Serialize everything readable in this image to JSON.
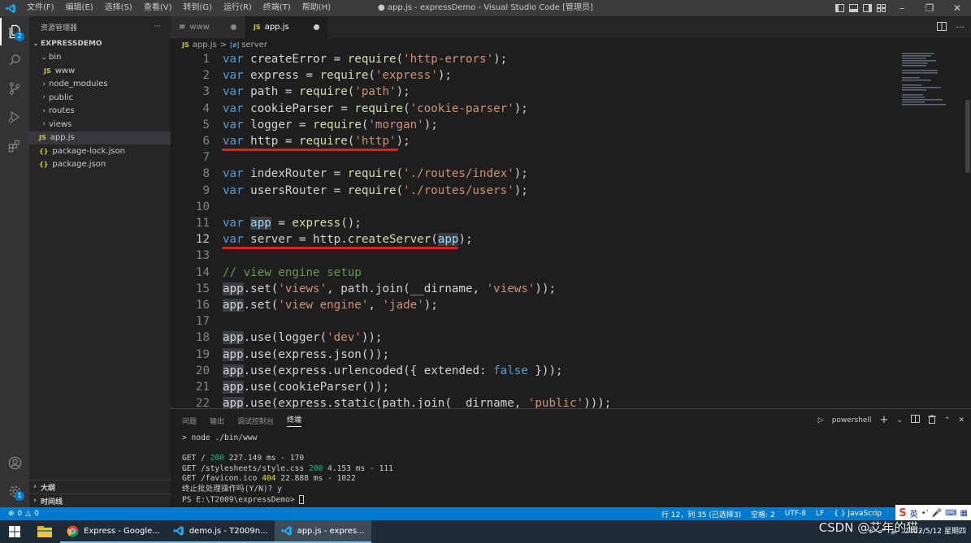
{
  "titlebar": {
    "menu": [
      "文件(F)",
      "编辑(E)",
      "选择(S)",
      "查看(V)",
      "转到(G)",
      "运行(R)",
      "终端(T)",
      "帮助(H)"
    ],
    "title": "● app.js - expressDemo - Visual Studio Code [管理员]"
  },
  "activitybar": {
    "explorer_badge": "2",
    "settings_badge": "1"
  },
  "sidebar": {
    "header": "资源管理器",
    "more": "···",
    "project": "EXPRESSDEMO",
    "items": [
      {
        "label": "bin",
        "kind": "folder-open"
      },
      {
        "label": "www",
        "kind": "js"
      },
      {
        "label": "node_modules",
        "kind": "folder"
      },
      {
        "label": "public",
        "kind": "folder"
      },
      {
        "label": "routes",
        "kind": "folder"
      },
      {
        "label": "views",
        "kind": "folder"
      },
      {
        "label": "app.js",
        "kind": "js"
      },
      {
        "label": "package-lock.json",
        "kind": "json"
      },
      {
        "label": "package.json",
        "kind": "json"
      }
    ],
    "outline": "大纲",
    "timeline": "时间线"
  },
  "tabs": [
    {
      "label": "www",
      "icon": "≡"
    },
    {
      "label": "app.js",
      "icon": "JS"
    }
  ],
  "breadcrumb": {
    "file": "app.js",
    "separator": ">",
    "symbol": "server"
  },
  "editor": {
    "current_line": 12,
    "lines": [
      {
        "n": "1"
      },
      {
        "n": "2"
      },
      {
        "n": "3"
      },
      {
        "n": "4"
      },
      {
        "n": "5"
      },
      {
        "n": "6"
      },
      {
        "n": "7"
      },
      {
        "n": "8"
      },
      {
        "n": "9"
      },
      {
        "n": "10"
      },
      {
        "n": "11"
      },
      {
        "n": "12"
      },
      {
        "n": "13"
      },
      {
        "n": "14"
      },
      {
        "n": "15"
      },
      {
        "n": "16"
      },
      {
        "n": "17"
      },
      {
        "n": "18"
      },
      {
        "n": "19"
      },
      {
        "n": "20"
      },
      {
        "n": "21"
      },
      {
        "n": "22"
      }
    ],
    "code": [
      [
        [
          "k",
          "var"
        ],
        [
          "p",
          " createError = "
        ],
        [
          "f",
          "require"
        ],
        [
          "p",
          "("
        ],
        [
          "s",
          "'http-errors'"
        ],
        [
          "p",
          ");"
        ]
      ],
      [
        [
          "k",
          "var"
        ],
        [
          "p",
          " express = "
        ],
        [
          "f",
          "require"
        ],
        [
          "p",
          "("
        ],
        [
          "s",
          "'express'"
        ],
        [
          "p",
          ");"
        ]
      ],
      [
        [
          "k",
          "var"
        ],
        [
          "p",
          " path = "
        ],
        [
          "f",
          "require"
        ],
        [
          "p",
          "("
        ],
        [
          "s",
          "'path'"
        ],
        [
          "p",
          ");"
        ]
      ],
      [
        [
          "k",
          "var"
        ],
        [
          "p",
          " cookieParser = "
        ],
        [
          "f",
          "require"
        ],
        [
          "p",
          "("
        ],
        [
          "s",
          "'cookie-parser'"
        ],
        [
          "p",
          ");"
        ]
      ],
      [
        [
          "k",
          "var"
        ],
        [
          "p",
          " logger = "
        ],
        [
          "f",
          "require"
        ],
        [
          "p",
          "("
        ],
        [
          "s",
          "'morgan'"
        ],
        [
          "p",
          ");"
        ]
      ],
      [
        [
          "k",
          "var"
        ],
        [
          "p",
          " http = "
        ],
        [
          "f",
          "require"
        ],
        [
          "p",
          "("
        ],
        [
          "s",
          "'http'"
        ],
        [
          "p",
          ");"
        ]
      ],
      [],
      [
        [
          "k",
          "var"
        ],
        [
          "p",
          " indexRouter = "
        ],
        [
          "f",
          "require"
        ],
        [
          "p",
          "("
        ],
        [
          "s",
          "'./routes/index'"
        ],
        [
          "p",
          ");"
        ]
      ],
      [
        [
          "k",
          "var"
        ],
        [
          "p",
          " usersRouter = "
        ],
        [
          "f",
          "require"
        ],
        [
          "p",
          "("
        ],
        [
          "s",
          "'./routes/users'"
        ],
        [
          "p",
          ");"
        ]
      ],
      [],
      [
        [
          "k",
          "var"
        ],
        [
          "p",
          " "
        ],
        [
          "vh",
          "app"
        ],
        [
          "p",
          " = "
        ],
        [
          "f",
          "express"
        ],
        [
          "p",
          "();"
        ]
      ],
      [
        [
          "k",
          "var"
        ],
        [
          "p",
          " server = http."
        ],
        [
          "f",
          "createServer"
        ],
        [
          "p",
          "("
        ],
        [
          "vh",
          "app"
        ],
        [
          "p",
          ");"
        ]
      ],
      [],
      [
        [
          "c",
          "// view engine setup"
        ]
      ],
      [
        [
          "ph",
          "app"
        ],
        [
          "p",
          ".set("
        ],
        [
          "s",
          "'views'"
        ],
        [
          "p",
          ", path.join(__dirname, "
        ],
        [
          "s",
          "'views'"
        ],
        [
          "p",
          "));"
        ]
      ],
      [
        [
          "ph",
          "app"
        ],
        [
          "p",
          ".set("
        ],
        [
          "s",
          "'view engine'"
        ],
        [
          "p",
          ", "
        ],
        [
          "s",
          "'jade'"
        ],
        [
          "p",
          ");"
        ]
      ],
      [],
      [
        [
          "ph",
          "app"
        ],
        [
          "p",
          ".use(logger("
        ],
        [
          "s",
          "'dev'"
        ],
        [
          "p",
          "));"
        ]
      ],
      [
        [
          "ph",
          "app"
        ],
        [
          "p",
          ".use(express.json());"
        ]
      ],
      [
        [
          "ph",
          "app"
        ],
        [
          "p",
          ".use(express.urlencoded({ extended: "
        ],
        [
          "k",
          "false"
        ],
        [
          "p",
          " }));"
        ]
      ],
      [
        [
          "ph",
          "app"
        ],
        [
          "p",
          ".use(cookieParser());"
        ]
      ],
      [
        [
          "ph",
          "app"
        ],
        [
          "p",
          ".use(express.static(path.join(__dirname, "
        ],
        [
          "s",
          "'public'"
        ],
        [
          "p",
          ")));"
        ]
      ]
    ]
  },
  "panel": {
    "tabs": [
      "问题",
      "输出",
      "调试控制台",
      "终端"
    ],
    "active_tab": "终端",
    "shell": "powershell",
    "terminal": [
      {
        "parts": [
          [
            "p",
            "> node ./bin/www"
          ]
        ]
      },
      {
        "parts": [
          [
            "p",
            ""
          ]
        ]
      },
      {
        "parts": [
          [
            "p",
            "GET / "
          ],
          [
            "g",
            "200"
          ],
          [
            "p",
            " 227.149 ms - 170"
          ]
        ]
      },
      {
        "parts": [
          [
            "p",
            "GET /stylesheets/style.css "
          ],
          [
            "g",
            "200"
          ],
          [
            "p",
            " 4.153 ms - 111"
          ]
        ]
      },
      {
        "parts": [
          [
            "p",
            "GET /favicon.ico "
          ],
          [
            "y",
            "404"
          ],
          [
            "p",
            " 22.888 ms - 1022"
          ]
        ]
      },
      {
        "parts": [
          [
            "p",
            "终止批处理操作吗(Y/N)? y"
          ]
        ]
      },
      {
        "parts": [
          [
            "p",
            "PS E:\\T2009\\expressDemo> "
          ]
        ]
      }
    ]
  },
  "statusbar": {
    "errors": "0",
    "warnings": "0",
    "position": "行 12，列 35 (已选择3)",
    "spaces": "空格: 2",
    "encoding": "UTF-8",
    "eol": "LF",
    "language": "{ } JavaScrip"
  },
  "taskbar": {
    "items": [
      {
        "label": "Express - Google...",
        "kind": "chrome"
      },
      {
        "label": "demo.js - T2009n...",
        "kind": "vscode"
      },
      {
        "label": "app.js - expres...",
        "kind": "vscode"
      }
    ],
    "time": "",
    "date": "2022/5/12 星期四",
    "ime": "英"
  },
  "watermark": "CSDN @艾年的猫."
}
